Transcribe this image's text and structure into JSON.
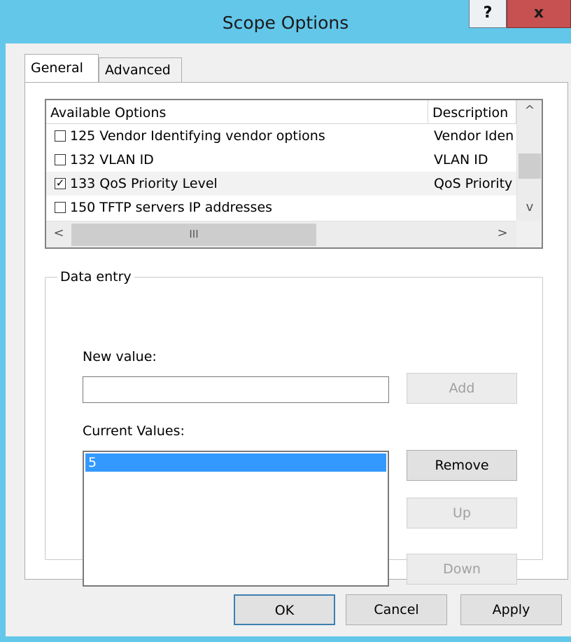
{
  "window": {
    "title": "Scope Options",
    "help_glyph": "?",
    "close_glyph": "x"
  },
  "tabs": [
    {
      "label": "General",
      "active": true
    },
    {
      "label": "Advanced",
      "active": false
    }
  ],
  "options_list": {
    "columns": [
      "Available Options",
      "Description"
    ],
    "rows": [
      {
        "checked": false,
        "name": "125 Vendor Identifying vendor options",
        "description": "Vendor Iden"
      },
      {
        "checked": false,
        "name": "132 VLAN ID",
        "description": "VLAN ID"
      },
      {
        "checked": true,
        "name": "133 QoS Priority Level",
        "description": "QoS Priority"
      },
      {
        "checked": false,
        "name": "150 TFTP servers IP addresses",
        "description": ""
      }
    ],
    "scroll": {
      "up": "^",
      "down": "v",
      "left": "<",
      "right": ">",
      "grip": "III"
    }
  },
  "data_entry": {
    "title": "Data entry",
    "new_value_label": "New value:",
    "new_value": "",
    "add_label": "Add",
    "current_values_label": "Current Values:",
    "current_values": [
      "5"
    ],
    "remove_label": "Remove",
    "up_label": "Up",
    "down_label": "Down"
  },
  "footer": {
    "ok_label": "OK",
    "cancel_label": "Cancel",
    "apply_label": "Apply"
  },
  "check_glyph": "✓",
  "colors": {
    "titlebar": "#63c7ea",
    "close": "#c75050",
    "selection": "#3399ff"
  }
}
